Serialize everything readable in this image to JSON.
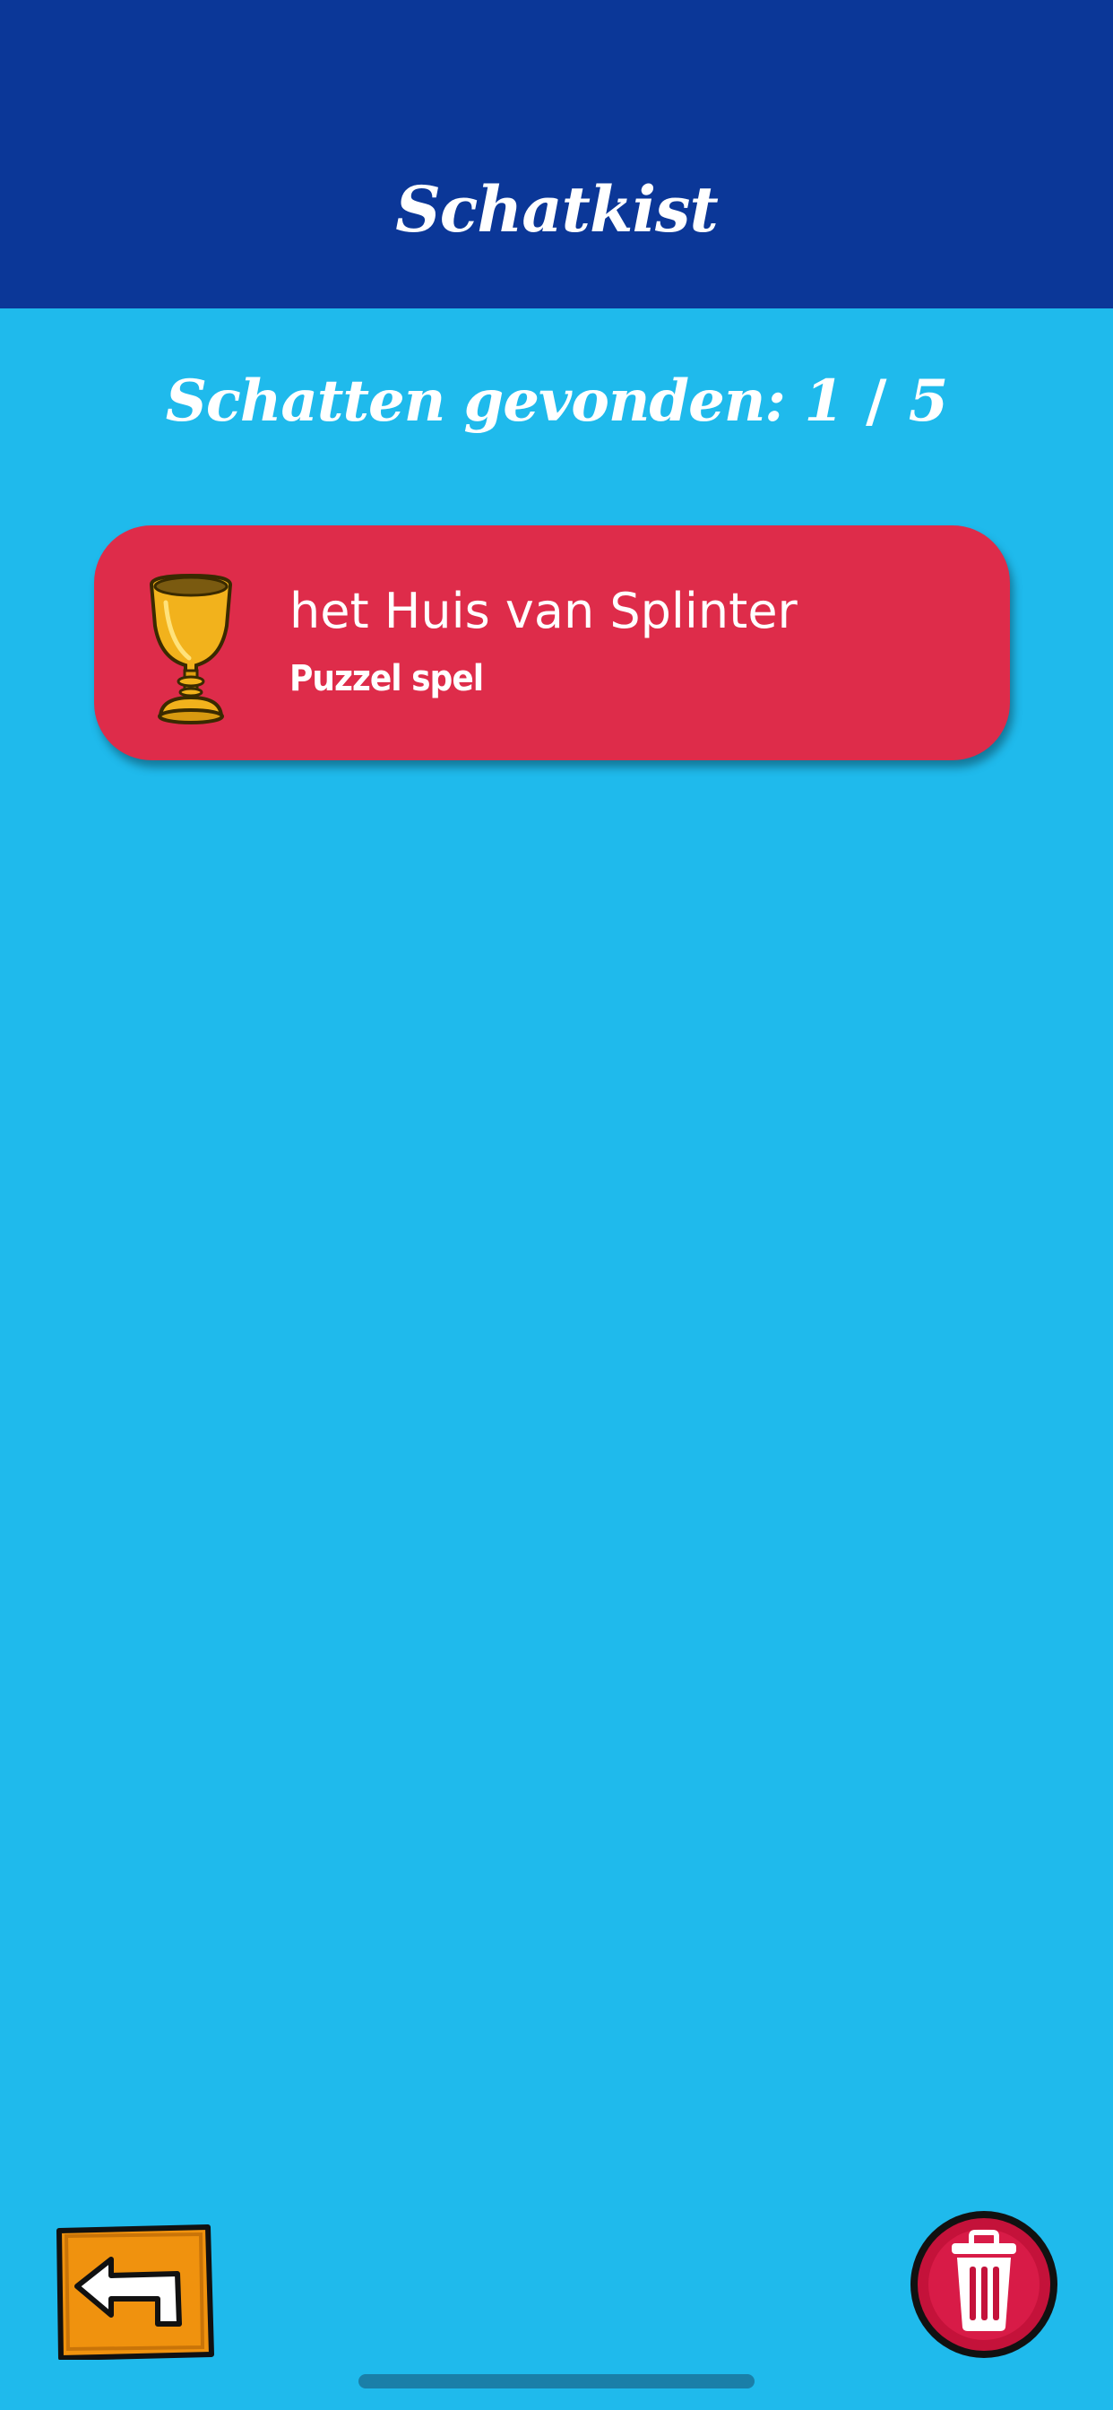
{
  "header": {
    "title": "Schatkist"
  },
  "summary": {
    "label": "Schatten gevonden:",
    "found": "1",
    "separator": "/",
    "total": "5"
  },
  "treasures": [
    {
      "title": "het Huis van Splinter",
      "subtitle": "Puzzel spel",
      "icon": "golden-goblet-icon"
    }
  ],
  "controls": {
    "back_icon": "back-arrow-icon",
    "delete_icon": "trash-icon"
  },
  "colors": {
    "header_bg": "#0b3798",
    "page_bg": "#1fbaec",
    "card_bg": "#de2c4a",
    "back_button": "#f0920e",
    "delete_button": "#c4123a"
  }
}
